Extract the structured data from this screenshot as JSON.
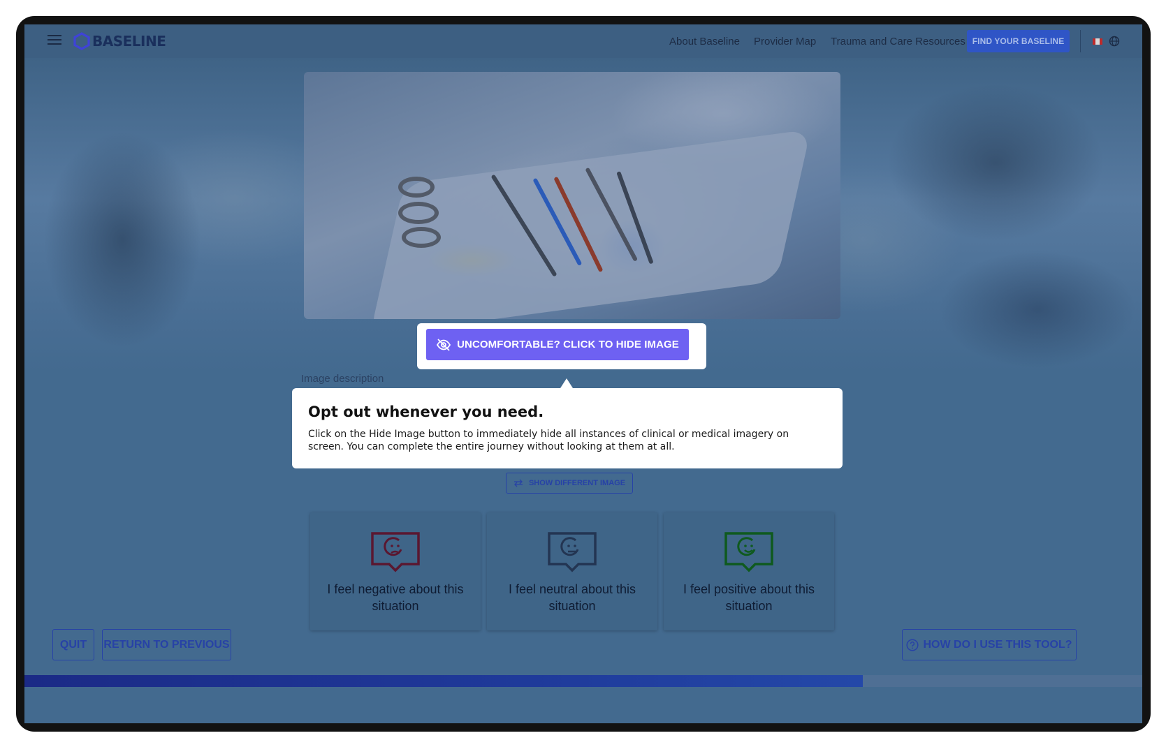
{
  "header": {
    "logo_text": "BASELINE",
    "nav": [
      "About Baseline",
      "Provider Map",
      "Trauma and Care Resources"
    ],
    "cta_label": "FIND YOUR BASELINE"
  },
  "hide_image": {
    "label": "UNCOMFORTABLE? CLICK TO HIDE IMAGE"
  },
  "image_description_label": "Image description",
  "tooltip": {
    "title": "Opt out whenever you need.",
    "body": "Click on the Hide Image button to immediately hide all instances of clinical or medical imagery on screen. You can complete the entire journey without looking at them at all."
  },
  "show_different_label": "SHOW DIFFERENT IMAGE",
  "feelings": [
    {
      "label": "I feel negative about this situation",
      "color": "#5a1730"
    },
    {
      "label": "I feel neutral about this situation",
      "color": "#233552"
    },
    {
      "label": "I feel positive about this situation",
      "color": "#0f5a1e"
    }
  ],
  "footer": {
    "quit_label": "QUIT",
    "return_label": "RETURN TO PREVIOUS",
    "help_label": "HOW DO I USE THIS TOOL?"
  },
  "progress": {
    "fraction": 0.75
  },
  "colors": {
    "accent": "#6e61f2",
    "outline": "#2742a6",
    "overlay": "#436a8f"
  }
}
